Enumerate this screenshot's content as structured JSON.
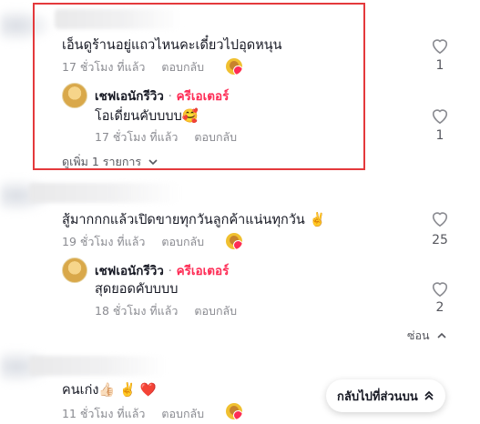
{
  "comments": [
    {
      "text": "เอ็นดูร้านอยู่แถวไหนคะเดี๋ยวไปอุดหนุน",
      "time": "17 ชั่วโมง ที่แล้ว",
      "reply_label": "ตอบกลับ",
      "likes": "1",
      "replies": [
        {
          "author": "เชฟเอนักรีวิว",
          "separator": "·",
          "badge": "ครีเอเตอร์",
          "text": "โอเดี่ยนคับบบบ🥰",
          "time": "17 ชั่วโมง ที่แล้ว",
          "reply_label": "ตอบกลับ",
          "likes": "1"
        }
      ],
      "see_more": "ดูเพิ่ม 1 รายการ"
    },
    {
      "text": "สู้มากกกแล้วเปิดขายทุกวันลูกค้าแน่นทุกวัน ✌️",
      "time": "19 ชั่วโมง ที่แล้ว",
      "reply_label": "ตอบกลับ",
      "likes": "25",
      "replies": [
        {
          "author": "เชฟเอนักรีวิว",
          "separator": "·",
          "badge": "ครีเอเตอร์",
          "text": "สุดยอดคับบบบ",
          "time": "18 ชั่วโมง ที่แล้ว",
          "reply_label": "ตอบกลับ",
          "likes": "2"
        }
      ],
      "hide_label": "ซ่อน"
    },
    {
      "text": "คนเก่ง👍🏻 ✌️ ❤️",
      "time": "11 ชั่วโมง ที่แล้ว",
      "reply_label": "ตอบกลับ"
    }
  ],
  "back_to_top": "กลับไปที่ส่วนบน",
  "colors": {
    "creator_badge": "#fe2c55",
    "highlight_border": "#e4393c"
  },
  "icons": [
    "heart-icon",
    "chevron-down-icon",
    "chevron-up-icon",
    "double-chevron-up-icon"
  ]
}
